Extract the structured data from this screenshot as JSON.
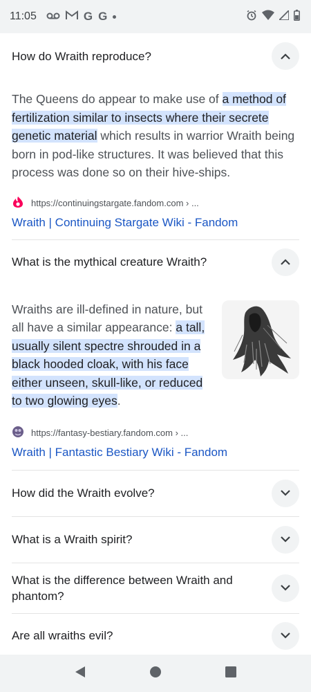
{
  "status_bar": {
    "time": "11:05",
    "left_icons": [
      "voicemail-icon",
      "gmail-icon",
      "google-icon",
      "google-icon",
      "dot-icon"
    ],
    "right_icons": [
      "alarm-icon",
      "wifi-icon",
      "signal-icon",
      "battery-icon"
    ]
  },
  "faq": [
    {
      "question": "How do Wraith reproduce?",
      "expanded": true,
      "answer_parts": [
        {
          "text": "The Queens do appear to make use of ",
          "highlight": false
        },
        {
          "text": "a method of fertilization similar to insects where their secrete genetic material",
          "highlight": true
        },
        {
          "text": " which results in warrior Wraith being born in pod-like structures. It was believed that this process was done so on their hive-ships.",
          "highlight": false
        }
      ],
      "source_url": "https://continuingstargate.fandom.com › ...",
      "source_title": "Wraith | Continuing Stargate Wiki - Fandom"
    },
    {
      "question": "What is the mythical creature Wraith?",
      "expanded": true,
      "answer_parts": [
        {
          "text": "Wraiths are ill-defined in nature, but all have a similar appearance: ",
          "highlight": false
        },
        {
          "text": "a tall, usually silent spectre shrouded in a black hooded cloak, with his face either unseen, skull-like, or reduced to two glowing eyes",
          "highlight": true
        },
        {
          "text": ".",
          "highlight": false
        }
      ],
      "source_url": "https://fantasy-bestiary.fandom.com › ...",
      "source_title": "Wraith | Fantastic Bestiary Wiki - Fandom"
    },
    {
      "question": "How did the Wraith evolve?",
      "expanded": false
    },
    {
      "question": "What is a Wraith spirit?",
      "expanded": false
    },
    {
      "question": "What is the difference between Wraith and phantom?",
      "expanded": false
    },
    {
      "question": "Are all wraiths evil?",
      "expanded": false
    }
  ],
  "colors": {
    "highlight": "#d3e3fd",
    "link": "#1a56c4",
    "chevron_bg": "#f1f3f4",
    "fandom_red": "#fa005a"
  },
  "nav_bar": {
    "icons": [
      "back-icon",
      "home-icon",
      "recents-icon"
    ]
  }
}
